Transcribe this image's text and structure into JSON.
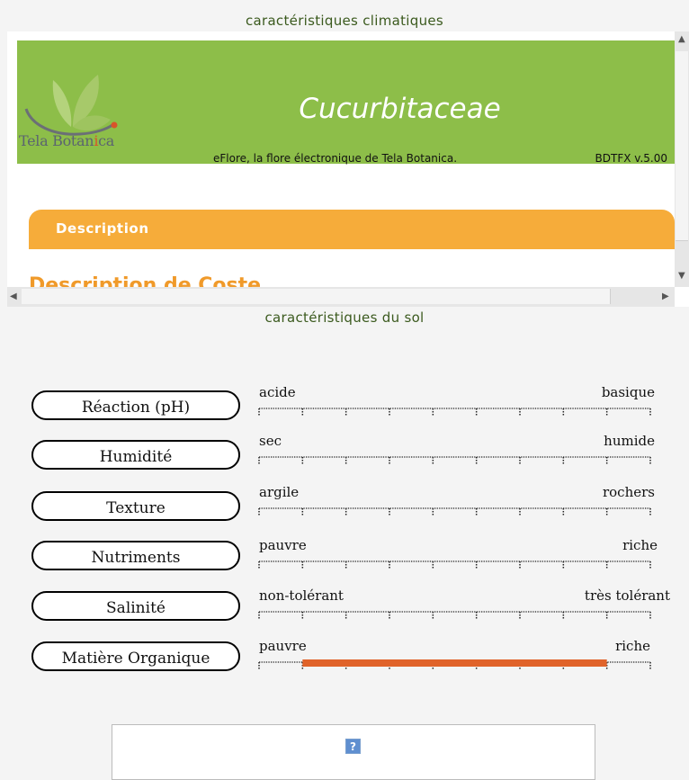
{
  "sections": {
    "climate_title": "caractéristiques climatiques",
    "soil_title": "caractéristiques du sol"
  },
  "embed": {
    "logo_text_pre": "Tela Botan",
    "logo_text_hi": "i",
    "logo_text_post": "ca",
    "family_name": "Cucurbitaceae",
    "tagline": "eFlore, la flore électronique de Tela Botanica.",
    "version": "BDTFX v.5.00",
    "description_label": "Description",
    "description_heading": "Description de Coste",
    "colors": {
      "banner": "#8dbe49",
      "tab": "#f6ac3a",
      "heading": "#f09a2a"
    }
  },
  "soil": {
    "rows": [
      {
        "name": "Réaction (pH)",
        "left": "acide",
        "right": "basique",
        "range": null
      },
      {
        "name": "Humidité",
        "left": "sec",
        "right": "humide",
        "range": null
      },
      {
        "name": "Texture",
        "left": "argile",
        "right": "rochers",
        "range": null
      },
      {
        "name": "Nutriments",
        "left": "pauvre",
        "right": "riche",
        "range": null
      },
      {
        "name": "Salinité",
        "left": "non-tolérant",
        "right": "très tolérant",
        "range": null
      },
      {
        "name": "Matière Organique",
        "left": "pauvre",
        "right": "riche",
        "range": [
          1,
          8
        ]
      }
    ],
    "scale_steps": 9,
    "bar_color": "#e0632a"
  },
  "help": {
    "icon": "help-icon",
    "glyph": "?"
  }
}
